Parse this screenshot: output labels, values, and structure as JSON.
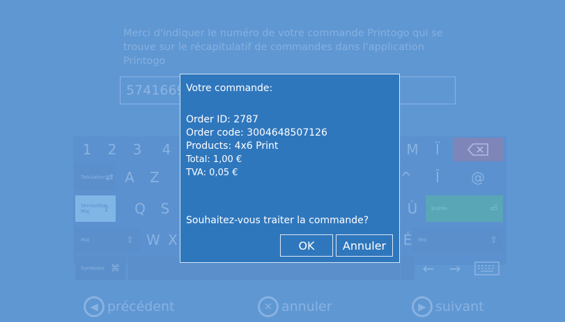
{
  "instruction": "Merci d'indiquer le numéro de votre commande Printogo qui se trouve sur le récapitulatif de commandes dans l'application Printogo",
  "order_input_value": "5741669",
  "keyboard": {
    "row1": [
      "1",
      "2",
      "3",
      "4",
      "M",
      "Ï"
    ],
    "row2_tab_label": "Tabulation",
    "row2": [
      "A",
      "Z",
      "^",
      "Î",
      "@"
    ],
    "row3_lock_label": "Verrouiller Maj",
    "row3": [
      "Q",
      "S",
      "Ù"
    ],
    "row3_enter_label": "Entrée",
    "row4_shift_label": "Maj",
    "row4": [
      "W",
      "X",
      "É"
    ],
    "row4_shift_right_label": "Maj",
    "row5_symbols_label": "Symboles"
  },
  "nav": {
    "previous": "précédent",
    "cancel": "annuler",
    "next": "suivant"
  },
  "dialog": {
    "title": "Votre commande:",
    "order_id": "Order ID: 2787",
    "order_code": "Order code: 3004648507126",
    "products": "Products: 4x6 Print",
    "total": "Total: 1,00 €",
    "tva": "TVA: 0,05 €",
    "question": "Souhaitez-vous traiter la commande?",
    "ok_label": "OK",
    "cancel_label": "Annuler"
  },
  "colors": {
    "background": "#5f97d3",
    "dialog": "#2f77bd",
    "backspace_key": "#7d85b9",
    "enter_key": "#59a6b7"
  }
}
